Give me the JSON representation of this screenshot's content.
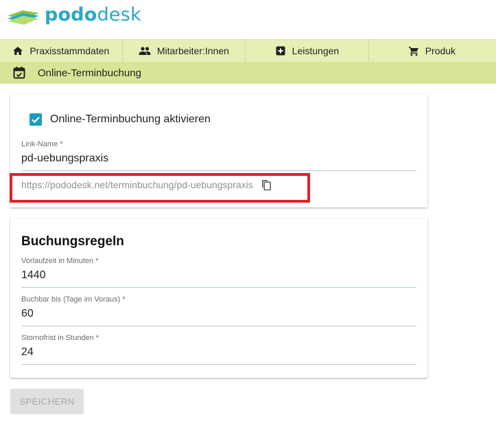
{
  "brand": {
    "part1": "podo",
    "part2": "desk"
  },
  "nav": {
    "items": [
      {
        "label": "Praxisstammdaten",
        "icon": "home-icon"
      },
      {
        "label": "Mitarbeiter:Innen",
        "icon": "people-icon"
      },
      {
        "label": "Leistungen",
        "icon": "add-box-icon"
      },
      {
        "label": "Produk",
        "icon": "cart-icon"
      }
    ]
  },
  "subnav": {
    "label": "Online-Terminbuchung",
    "icon": "calendar-check-icon"
  },
  "online_booking": {
    "checkbox_label": "Online-Terminbuchung aktivieren",
    "checked": true,
    "link_name_label": "Link-Name *",
    "link_name_value": "pd-uebungspraxis",
    "public_url": "https://pododesk.net/terminbuchung/pd-uebungspraxis"
  },
  "rules": {
    "title": "Buchungsregeln",
    "fields": [
      {
        "label": "Vorlaufzeit in Minuten *",
        "value": "1440"
      },
      {
        "label": "Buchbar bis (Tage im Voraus) *",
        "value": "60"
      },
      {
        "label": "Stornofrist in Stunden *",
        "value": "24"
      }
    ]
  },
  "save_label": "SPEICHERN",
  "colors": {
    "brand": "#2aa8c9",
    "nav_bg": "#e6efb5",
    "subnav_bg": "#d9e596",
    "checkbox": "#1a9bc4",
    "highlight": "#e0202a"
  }
}
